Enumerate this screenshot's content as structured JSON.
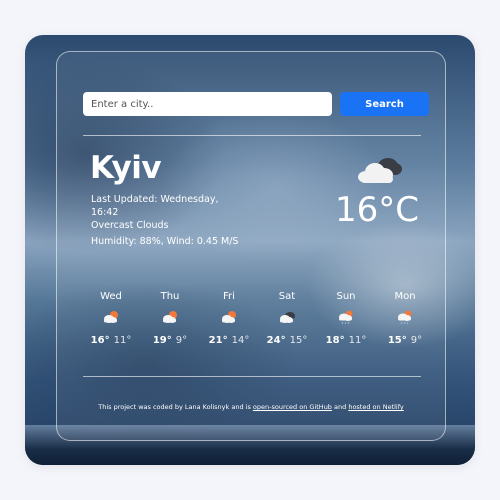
{
  "search": {
    "placeholder": "Enter a city..",
    "value": "",
    "button_label": "Search"
  },
  "current": {
    "city": "Kyiv",
    "last_updated": "Last Updated: Wednesday, 16:42",
    "description": "Overcast Clouds",
    "humidity_wind": "Humidity: 88%, Wind: 0.45 M/S",
    "temperature": "16°C",
    "icon": "overcast-clouds-icon"
  },
  "forecast": [
    {
      "day": "Wed",
      "max": "16°",
      "min": "11°",
      "icon": "sun-cloud-icon"
    },
    {
      "day": "Thu",
      "max": "19°",
      "min": "9°",
      "icon": "sun-cloud-icon"
    },
    {
      "day": "Fri",
      "max": "21°",
      "min": "14°",
      "icon": "sun-cloud-icon"
    },
    {
      "day": "Sat",
      "max": "24°",
      "min": "15°",
      "icon": "clouds-icon"
    },
    {
      "day": "Sun",
      "max": "18°",
      "min": "11°",
      "icon": "sun-rain-icon"
    },
    {
      "day": "Mon",
      "max": "15°",
      "min": "9°",
      "icon": "sun-rain-icon"
    }
  ],
  "footer": {
    "text_before": "This project was coded by Lana Kolisnyk and is ",
    "link_github": "open-sourced on GitHub",
    "text_middle": " and ",
    "link_netlify": "hosted on Netlify"
  },
  "colors": {
    "accent": "#1a73f5",
    "text": "#ffffff"
  }
}
